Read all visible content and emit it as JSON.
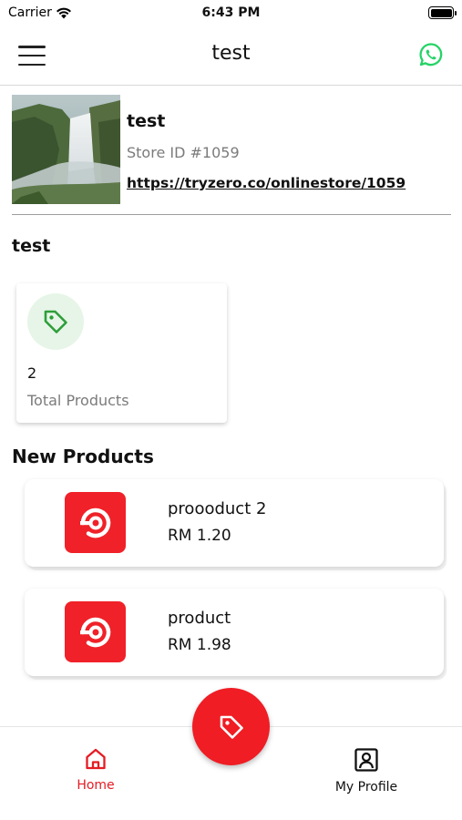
{
  "status_bar": {
    "carrier": "Carrier",
    "time": "6:43 PM"
  },
  "nav": {
    "title": "test",
    "menu_icon": "menu-icon",
    "action_icon": "whatsapp-icon"
  },
  "store": {
    "name": "test",
    "store_id": "Store ID #1059",
    "link": "https://tryzero.co/onlinestore/1059"
  },
  "section_store_title": "test",
  "stats": {
    "icon": "tag-icon",
    "value": "2",
    "label": "Total Products"
  },
  "new_products": {
    "title": "New Products",
    "items": [
      {
        "name": "proooduct 2",
        "price": "RM 1.20",
        "icon": "product-logo-icon"
      },
      {
        "name": "product",
        "price": "RM 1.98",
        "icon": "product-logo-icon"
      }
    ]
  },
  "tab_bar": {
    "home_label": "Home",
    "profile_label": "My Profile",
    "fab_icon": "tag-icon"
  },
  "colors": {
    "accent": "#F01D24",
    "whatsapp": "#25D366",
    "tag_green": "#2E9E3A",
    "muted": "#7B7B7B"
  }
}
